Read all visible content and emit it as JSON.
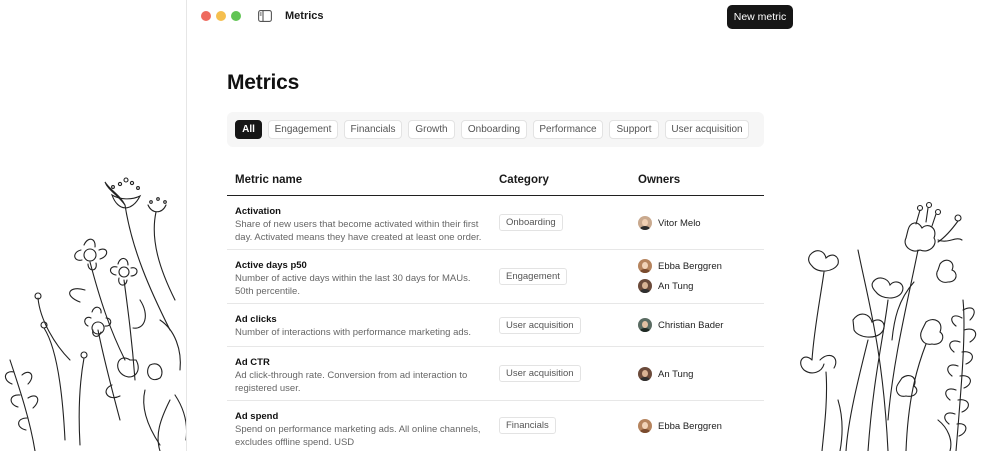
{
  "window": {
    "title": "Metrics",
    "new_button_label": "New metric"
  },
  "page": {
    "heading": "Metrics"
  },
  "filters": [
    {
      "label": "All",
      "active": true
    },
    {
      "label": "Engagement",
      "active": false
    },
    {
      "label": "Financials",
      "active": false
    },
    {
      "label": "Growth",
      "active": false
    },
    {
      "label": "Onboarding",
      "active": false
    },
    {
      "label": "Performance",
      "active": false
    },
    {
      "label": "Support",
      "active": false
    },
    {
      "label": "User acquisition",
      "active": false
    }
  ],
  "table": {
    "headers": {
      "name": "Metric name",
      "category": "Category",
      "owners": "Owners"
    },
    "rows": [
      {
        "name": "Activation",
        "description": "Share of new users that become activated within their first day. Activated means they have created at least one order.",
        "category": "Onboarding",
        "owners": [
          "Vitor Melo"
        ]
      },
      {
        "name": "Active days p50",
        "description": "Number of active days within the last 30 days for MAUs. 50th percentile.",
        "category": "Engagement",
        "owners": [
          "Ebba Berggren",
          "An Tung"
        ]
      },
      {
        "name": "Ad clicks",
        "description": "Number of interactions with performance marketing ads.",
        "category": "User acquisition",
        "owners": [
          "Christian Bader"
        ]
      },
      {
        "name": "Ad CTR",
        "description": "Ad click-through rate. Conversion from ad interaction to registered user.",
        "category": "User acquisition",
        "owners": [
          "An Tung"
        ]
      },
      {
        "name": "Ad spend",
        "description": "Spend on performance marketing ads. All online channels, excludes offline spend. USD",
        "category": "Financials",
        "owners": [
          "Ebba Berggren"
        ]
      }
    ]
  },
  "colors": {
    "accent_dark": "#161616",
    "traffic_red": "#ee6a5e",
    "traffic_yellow": "#f5bf4f",
    "traffic_green": "#61c454"
  },
  "icons": {
    "sidebar_toggle": "sidebar-toggle-icon",
    "decor_left": "flowers-illustration-left",
    "decor_right": "flowers-illustration-right"
  }
}
